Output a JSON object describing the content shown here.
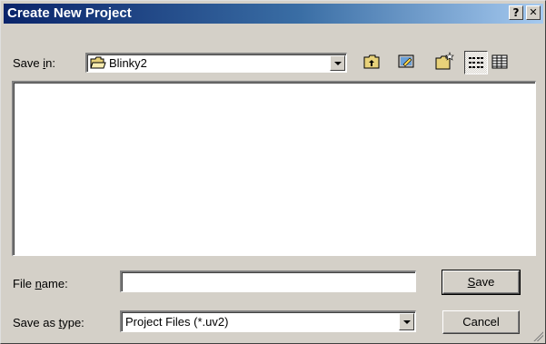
{
  "titlebar": {
    "title": "Create New Project",
    "help_glyph": "?",
    "close_glyph": "✕"
  },
  "save_in": {
    "label_prefix": "Save ",
    "label_hotkey": "i",
    "label_suffix": "n:",
    "value": "Blinky2",
    "icon": "folder-open-icon"
  },
  "toolbar": {
    "buttons": [
      {
        "name": "up-one-level",
        "icon": "folder-up-icon"
      },
      {
        "name": "create-new-folder",
        "icon": "new-folder-icon"
      },
      {
        "name": "list-view",
        "icon": "list-view-icon"
      },
      {
        "name": "details-view",
        "icon": "details-view-icon"
      }
    ]
  },
  "file_name": {
    "label_prefix": "File ",
    "label_hotkey": "n",
    "label_suffix": "ame:",
    "value": ""
  },
  "save_as_type": {
    "label_prefix": "Save as ",
    "label_hotkey": "t",
    "label_suffix": "ype:",
    "value": "Project Files (*.uv2)"
  },
  "buttons": {
    "save_hotkey": "S",
    "save_rest": "ave",
    "cancel": "Cancel"
  },
  "colors": {
    "title_gradient_start": "#0a246a",
    "title_gradient_end": "#a6caf0",
    "face": "#d4d0c8",
    "folder": "#e8d27a"
  }
}
